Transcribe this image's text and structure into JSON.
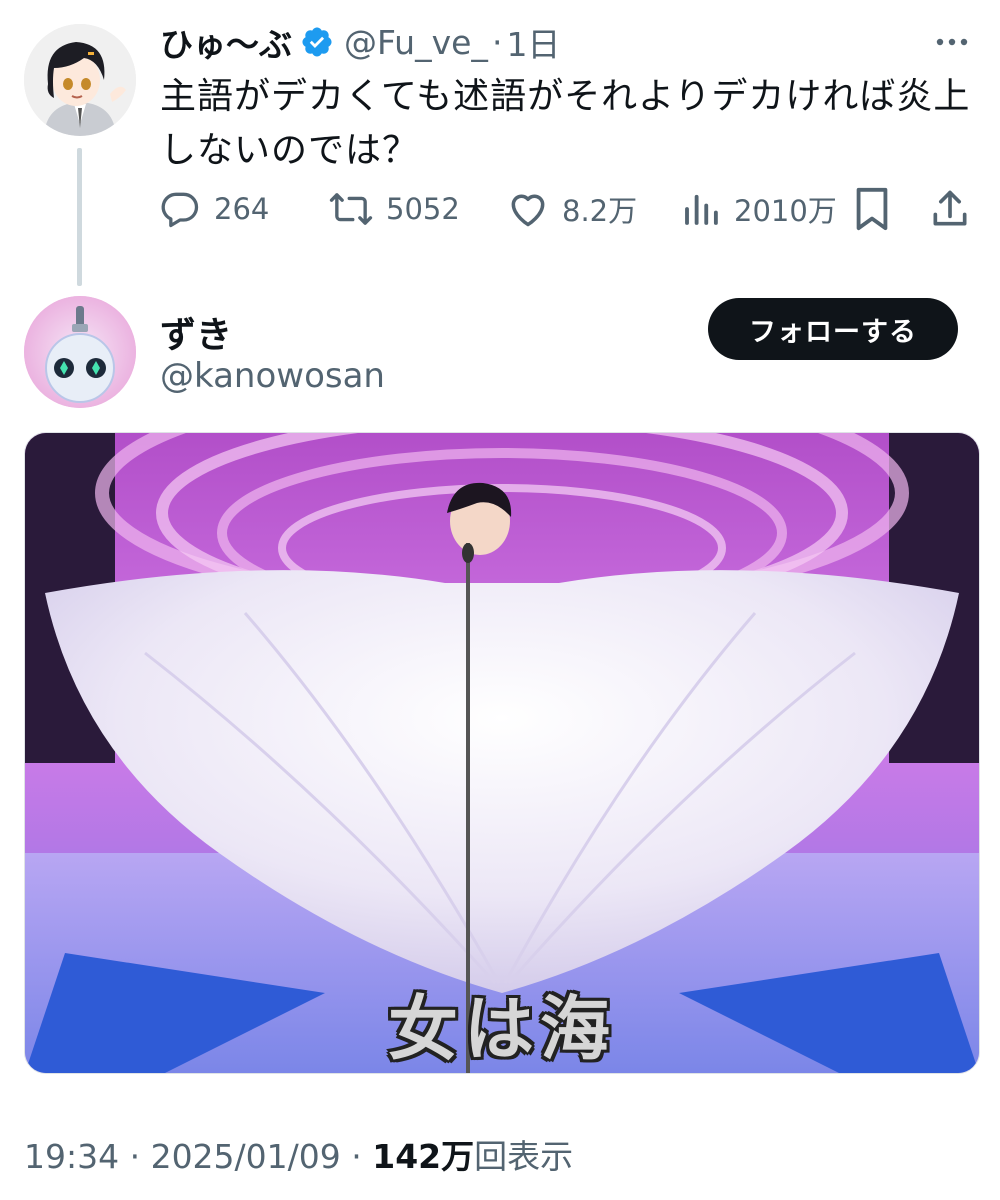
{
  "parent_tweet": {
    "display_name": "ひゅ〜ぶ",
    "handle": "@Fu_ve_",
    "separator": "·",
    "time": "1日",
    "text": "主語がデカくても述語がそれよりデカければ炎上しないのでは？",
    "metrics": {
      "replies": "264",
      "retweets": "5052",
      "likes": "8.2万",
      "views": "2010万"
    }
  },
  "main_tweet": {
    "display_name": "ずき",
    "handle": "@kanowosan",
    "follow_label": "フォローする",
    "image_caption": "女は海",
    "timestamp": "19:34 · 2025/01/09 · ",
    "view_count": "142万",
    "view_suffix": "回表示"
  },
  "colors": {
    "text_primary": "#0f1419",
    "text_secondary": "#536471",
    "verified_blue": "#1d9bf0",
    "thread_line": "#cfd9de"
  },
  "icons": [
    "verified-badge-icon",
    "more-icon",
    "reply-icon",
    "retweet-icon",
    "like-icon",
    "views-icon",
    "bookmark-icon",
    "share-icon"
  ]
}
